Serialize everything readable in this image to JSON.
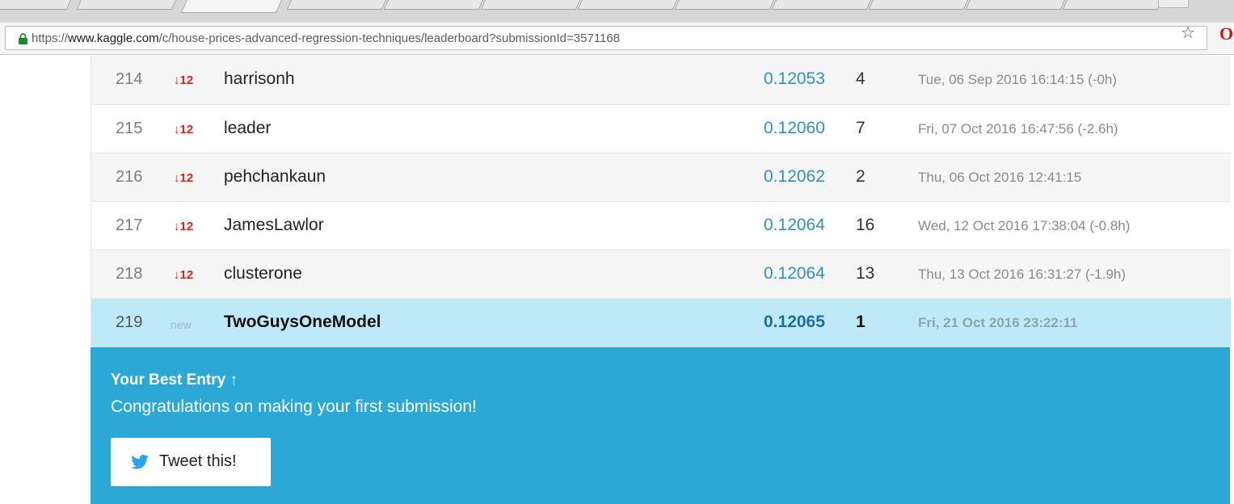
{
  "browser": {
    "url_scheme": "https://",
    "url_host": "www.kaggle.com",
    "url_path": "/c/house-prices-advanced-regression-techniques/leaderboard?submissionId=3571168",
    "star_icon": "star-icon",
    "browser_icon": "opera-icon",
    "opera_glyph": "O"
  },
  "leaderboard": {
    "rows": [
      {
        "rank": "214",
        "delta": "↓12",
        "team": "harrisonh",
        "score": "0.12053",
        "entries": "4",
        "last": "Tue, 06 Sep 2016 16:14:15 (-0h)"
      },
      {
        "rank": "215",
        "delta": "↓12",
        "team": "leader",
        "score": "0.12060",
        "entries": "7",
        "last": "Fri, 07 Oct 2016 16:47:56 (-2.6h)"
      },
      {
        "rank": "216",
        "delta": "↓12",
        "team": "pehchankaun",
        "score": "0.12062",
        "entries": "2",
        "last": "Thu, 06 Oct 2016 12:41:15"
      },
      {
        "rank": "217",
        "delta": "↓12",
        "team": "JamesLawlor",
        "score": "0.12064",
        "entries": "16",
        "last": "Wed, 12 Oct 2016 17:38:04 (-0.8h)"
      },
      {
        "rank": "218",
        "delta": "↓12",
        "team": "clusterone",
        "score": "0.12064",
        "entries": "13",
        "last": "Thu, 13 Oct 2016 16:31:27 (-1.9h)"
      },
      {
        "rank": "219",
        "delta": "new",
        "team": "TwoGuysOneModel",
        "score": "0.12065",
        "entries": "1",
        "last": "Fri, 21 Oct 2016 23:22:11"
      }
    ]
  },
  "best_entry": {
    "title": "Your Best Entry ↑",
    "message": "Congratulations on making your first submission!",
    "tweet_label": "Tweet this!",
    "tweet_icon": "twitter-icon"
  },
  "colors": {
    "score_blue": "#2e8fc6",
    "delta_red": "#e02020",
    "highlight_row": "#bde9f8",
    "panel_blue": "#2ca8d6"
  }
}
